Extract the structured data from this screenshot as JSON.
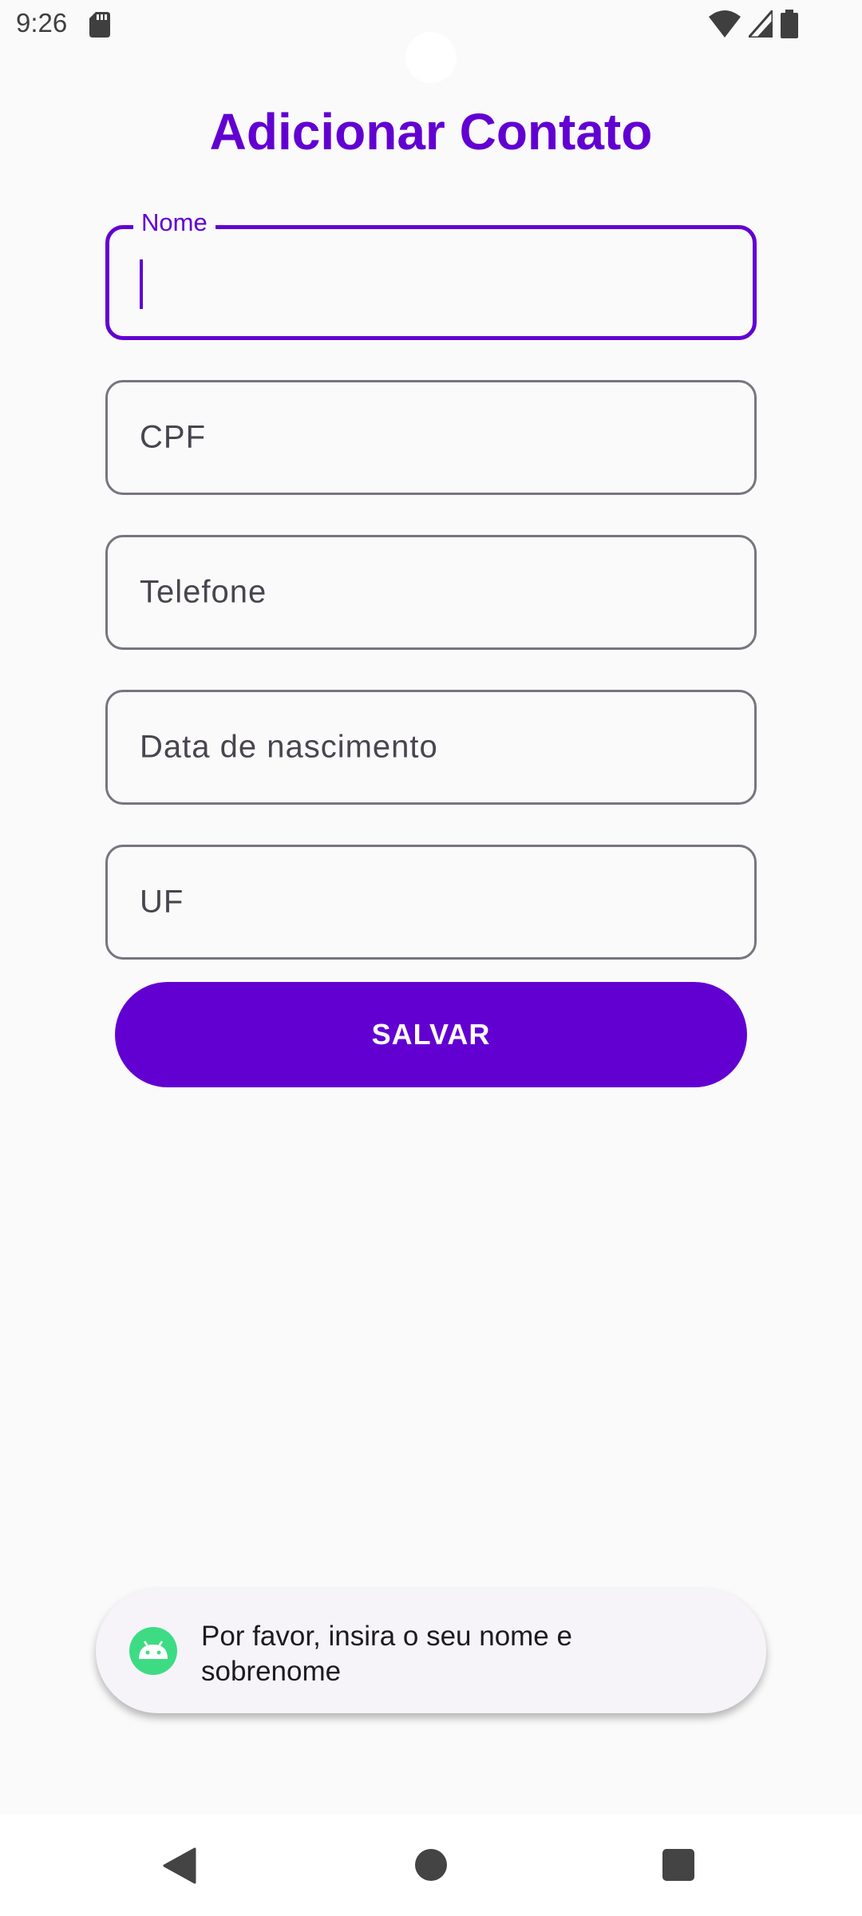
{
  "status_bar": {
    "time": "9:26",
    "icons": [
      "sd-card-icon",
      "wifi-icon",
      "cellular-signal-icon",
      "battery-icon"
    ]
  },
  "page": {
    "title": "Adicionar Contato"
  },
  "form": {
    "fields": [
      {
        "label": "Nome",
        "value": "",
        "state": "focused"
      },
      {
        "placeholder": "CPF",
        "value": ""
      },
      {
        "placeholder": "Telefone",
        "value": ""
      },
      {
        "placeholder": "Data de nascimento",
        "value": ""
      },
      {
        "placeholder": "UF",
        "value": ""
      }
    ],
    "save_label": "SALVAR"
  },
  "toast": {
    "icon": "android-icon",
    "message": "Por favor, insira o seu nome e sobrenome"
  },
  "navigation": {
    "icons": [
      "back-icon",
      "home-icon",
      "recents-icon"
    ]
  },
  "colors": {
    "accent": "#6200d2",
    "field_border": "#79747e",
    "background": "#fafafa"
  }
}
